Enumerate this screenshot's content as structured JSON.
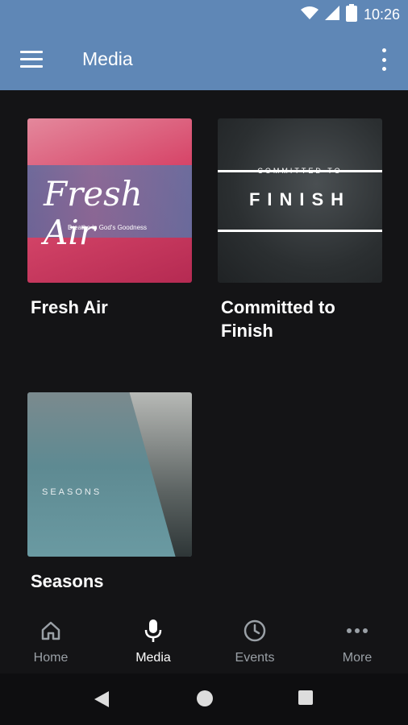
{
  "status": {
    "time": "10:26",
    "icons": [
      "wifi-icon",
      "signal-icon",
      "battery-icon"
    ]
  },
  "appbar": {
    "title": "Media",
    "menu_icon": "menu-icon",
    "overflow_icon": "more-vert-icon"
  },
  "media": [
    {
      "title": "Fresh Air",
      "art_script": "Fresh Air",
      "art_tagline": "Breathe in God's Goodness"
    },
    {
      "title": "Committed to Finish",
      "art_small": "COMMITTED TO",
      "art_big": "FINISH"
    },
    {
      "title": "Seasons",
      "art_label": "SEASONS"
    }
  ],
  "bottom_nav": [
    {
      "label": "Home",
      "icon": "home-icon",
      "active": false
    },
    {
      "label": "Media",
      "icon": "mic-icon",
      "active": true
    },
    {
      "label": "Events",
      "icon": "clock-icon",
      "active": false
    },
    {
      "label": "More",
      "icon": "more-horiz-icon",
      "active": false
    }
  ],
  "colors": {
    "appbar": "#5f87b6",
    "background": "#141416",
    "active_tab": "#ffffff",
    "inactive_tab": "#9aa0a6"
  }
}
